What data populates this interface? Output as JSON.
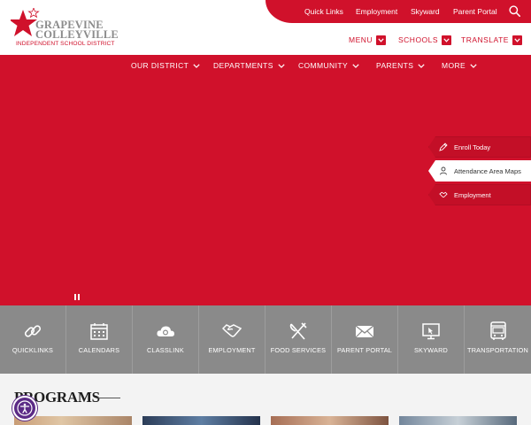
{
  "logo": {
    "line1": "GRAPEVINE",
    "line2": "COLLEYVILLE",
    "line3": "INDEPENDENT SCHOOL DISTRICT"
  },
  "top_links": [
    "Quick Links",
    "Employment",
    "Skyward",
    "Parent Portal"
  ],
  "nav2": {
    "menu": "MENU",
    "schools": "SCHOOLS",
    "translate": "TRANSLATE"
  },
  "main_nav": [
    "OUR DISTRICT",
    "DEPARTMENTS",
    "COMMUNITY",
    "PARENTS",
    "MORE"
  ],
  "hero_links": [
    {
      "label": "Enroll Today",
      "icon": "pencil-icon"
    },
    {
      "label": "Attendance Area Maps",
      "icon": "map-person-icon"
    },
    {
      "label": "Employment",
      "icon": "handshake-icon"
    }
  ],
  "quick_tiles": [
    {
      "label": "QUICKLINKS",
      "icon": "link-icon"
    },
    {
      "label": "CALENDARS",
      "icon": "calendar-icon"
    },
    {
      "label": "CLASSLINK",
      "icon": "cloud-icon"
    },
    {
      "label": "EMPLOYMENT",
      "icon": "handshake-icon"
    },
    {
      "label": "FOOD SERVICES",
      "icon": "utensils-icon"
    },
    {
      "label": "PARENT PORTAL",
      "icon": "envelope-icon"
    },
    {
      "label": "SKYWARD",
      "icon": "monitor-icon"
    },
    {
      "label": "TRANSPORTATION",
      "icon": "bus-icon"
    }
  ],
  "programs": {
    "title": "PROGRAMS"
  },
  "colors": {
    "brand_red": "#d0112b",
    "tile_gray": "#8a8a8a",
    "logo_gray": "#8b8b8b",
    "a11y_purple": "#5b2a86"
  }
}
